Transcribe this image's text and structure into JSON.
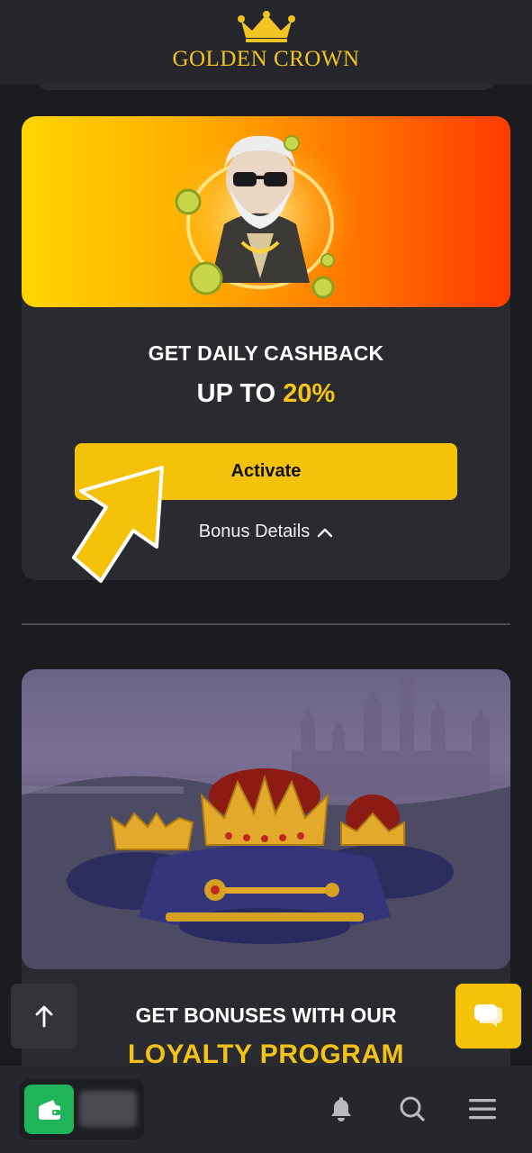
{
  "header": {
    "brand": "GOLDEN CROWN"
  },
  "cashback": {
    "title": "GET DAILY CASHBACK",
    "amount_prefix": "UP TO ",
    "amount_value": "20%",
    "activate_label": "Activate",
    "details_label": "Bonus Details"
  },
  "loyalty": {
    "title": "GET BONUSES WITH OUR",
    "subtitle": "LOYALTY PROGRAM"
  },
  "bottom_nav": {
    "icons": [
      "wallet-icon",
      "bell-icon",
      "search-icon",
      "menu-icon"
    ]
  },
  "colors": {
    "accent": "#f5c20a",
    "wallet": "#1fb35a",
    "background": "#1b1c20",
    "card": "#2a2b30"
  }
}
